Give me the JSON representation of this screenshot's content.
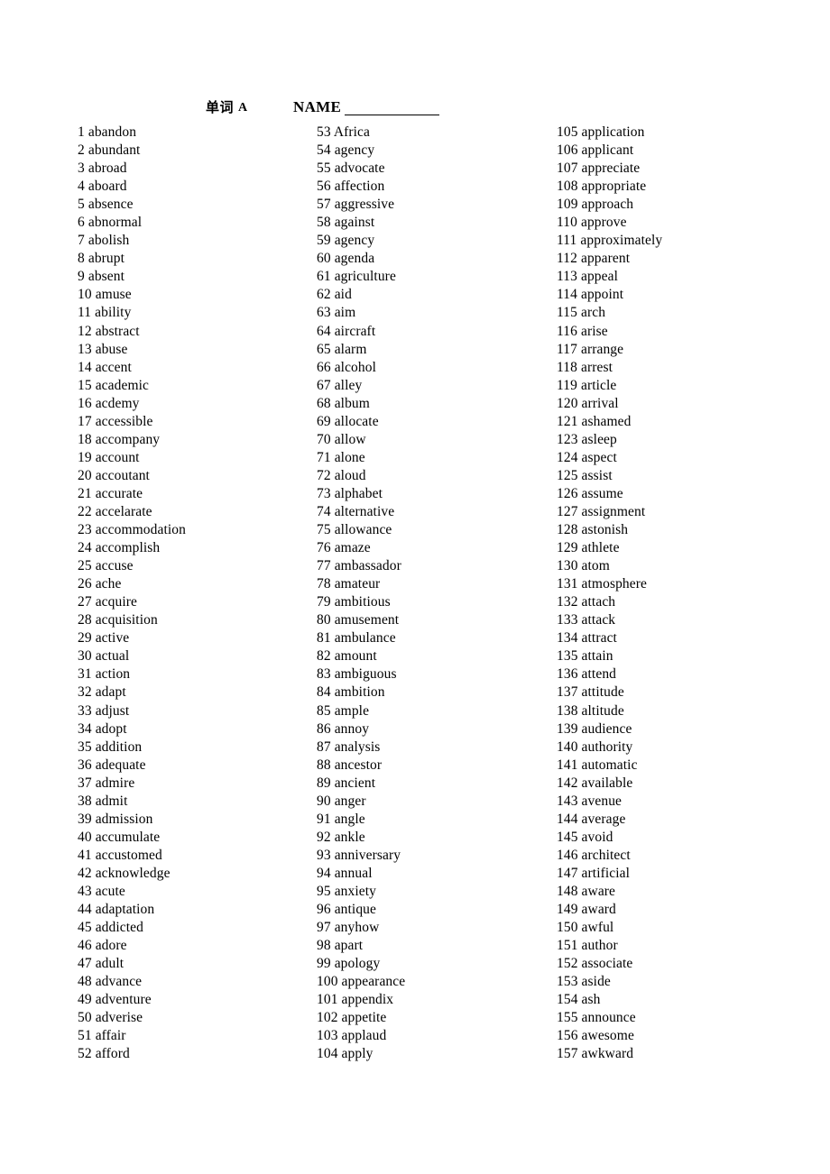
{
  "header": {
    "title_cjk": "单词",
    "title_letter": "A",
    "name_label": "NAME",
    "name_value": ""
  },
  "columns": [
    {
      "id": "column-1",
      "entries": [
        {
          "num": "1",
          "word": "abandon"
        },
        {
          "num": "2",
          "word": "abundant"
        },
        {
          "num": "3",
          "word": "abroad"
        },
        {
          "num": "4",
          "word": "aboard"
        },
        {
          "num": "5",
          "word": "absence"
        },
        {
          "num": "6",
          "word": "abnormal"
        },
        {
          "num": "7",
          "word": "abolish"
        },
        {
          "num": "8",
          "word": "abrupt"
        },
        {
          "num": "9",
          "word": "absent"
        },
        {
          "num": "10",
          "word": "amuse"
        },
        {
          "num": "11",
          "word": "ability"
        },
        {
          "num": "12",
          "word": "abstract"
        },
        {
          "num": "13",
          "word": "abuse"
        },
        {
          "num": "14",
          "word": "accent"
        },
        {
          "num": "15",
          "word": "academic"
        },
        {
          "num": "16",
          "word": "acdemy"
        },
        {
          "num": "17",
          "word": "accessible"
        },
        {
          "num": "18",
          "word": "accompany"
        },
        {
          "num": "19",
          "word": "account"
        },
        {
          "num": "20",
          "word": "accoutant"
        },
        {
          "num": "21",
          "word": "accurate"
        },
        {
          "num": "22",
          "word": "accelarate"
        },
        {
          "num": "23",
          "word": "accommodation"
        },
        {
          "num": "24",
          "word": "accomplish"
        },
        {
          "num": "25",
          "word": "accuse"
        },
        {
          "num": "26",
          "word": "ache"
        },
        {
          "num": "27",
          "word": "acquire"
        },
        {
          "num": "28",
          "word": "acquisition"
        },
        {
          "num": "29",
          "word": "active"
        },
        {
          "num": "30",
          "word": "actual"
        },
        {
          "num": "31",
          "word": "action"
        },
        {
          "num": "32",
          "word": "adapt"
        },
        {
          "num": "33",
          "word": "adjust"
        },
        {
          "num": "34",
          "word": "adopt"
        },
        {
          "num": "35",
          "word": "addition"
        },
        {
          "num": "36",
          "word": "adequate"
        },
        {
          "num": "37",
          "word": "admire"
        },
        {
          "num": "38",
          "word": "admit"
        },
        {
          "num": "39",
          "word": "admission"
        },
        {
          "num": "40",
          "word": "accumulate"
        },
        {
          "num": "41",
          "word": "accustomed"
        },
        {
          "num": "42",
          "word": "acknowledge"
        },
        {
          "num": "43",
          "word": "acute"
        },
        {
          "num": "44",
          "word": "adaptation"
        },
        {
          "num": "45",
          "word": "addicted"
        },
        {
          "num": "46",
          "word": "adore"
        },
        {
          "num": "47",
          "word": "adult"
        },
        {
          "num": "48",
          "word": "advance"
        },
        {
          "num": "49",
          "word": "adventure"
        },
        {
          "num": "50",
          "word": "adverise"
        },
        {
          "num": "51",
          "word": "affair"
        },
        {
          "num": "52",
          "word": "afford"
        }
      ]
    },
    {
      "id": "column-2",
      "entries": [
        {
          "num": "53",
          "word": "Africa"
        },
        {
          "num": "54",
          "word": "agency"
        },
        {
          "num": "55",
          "word": "advocate"
        },
        {
          "num": "56",
          "word": "affection"
        },
        {
          "num": "57",
          "word": "aggressive"
        },
        {
          "num": "58",
          "word": "against"
        },
        {
          "num": "59",
          "word": "agency"
        },
        {
          "num": "60",
          "word": "agenda"
        },
        {
          "num": "61",
          "word": "agriculture"
        },
        {
          "num": "62",
          "word": "aid"
        },
        {
          "num": "63",
          "word": "aim"
        },
        {
          "num": "64",
          "word": "aircraft"
        },
        {
          "num": "65",
          "word": "alarm"
        },
        {
          "num": "66",
          "word": "alcohol"
        },
        {
          "num": "67",
          "word": "alley"
        },
        {
          "num": "68",
          "word": "album"
        },
        {
          "num": "69",
          "word": "allocate"
        },
        {
          "num": "70",
          "word": "allow"
        },
        {
          "num": "71",
          "word": "alone"
        },
        {
          "num": "72",
          "word": "aloud"
        },
        {
          "num": "73",
          "word": "alphabet"
        },
        {
          "num": "74",
          "word": "alternative"
        },
        {
          "num": "75",
          "word": "allowance"
        },
        {
          "num": "76",
          "word": "amaze"
        },
        {
          "num": "77",
          "word": "ambassador"
        },
        {
          "num": "78",
          "word": "amateur"
        },
        {
          "num": "79",
          "word": "ambitious"
        },
        {
          "num": "80",
          "word": "amusement"
        },
        {
          "num": "81",
          "word": "ambulance"
        },
        {
          "num": "82",
          "word": "amount"
        },
        {
          "num": "83",
          "word": "ambiguous"
        },
        {
          "num": "84",
          "word": "ambition"
        },
        {
          "num": "85",
          "word": "ample"
        },
        {
          "num": "86",
          "word": "annoy"
        },
        {
          "num": "87",
          "word": "analysis"
        },
        {
          "num": "88",
          "word": "ancestor"
        },
        {
          "num": "89",
          "word": "ancient"
        },
        {
          "num": "90",
          "word": "anger"
        },
        {
          "num": "91",
          "word": "angle"
        },
        {
          "num": "92",
          "word": "ankle"
        },
        {
          "num": "93",
          "word": "anniversary"
        },
        {
          "num": "94",
          "word": "annual"
        },
        {
          "num": "95",
          "word": "anxiety"
        },
        {
          "num": "96",
          "word": "antique"
        },
        {
          "num": "97",
          "word": "anyhow"
        },
        {
          "num": "98",
          "word": "apart"
        },
        {
          "num": "99",
          "word": "apology"
        },
        {
          "num": "100",
          "word": "appearance"
        },
        {
          "num": "101",
          "word": "appendix"
        },
        {
          "num": "102",
          "word": "appetite"
        },
        {
          "num": "103",
          "word": "applaud"
        },
        {
          "num": "104",
          "word": "apply"
        }
      ]
    },
    {
      "id": "column-3",
      "entries": [
        {
          "num": "105",
          "word": "application"
        },
        {
          "num": "106",
          "word": "applicant"
        },
        {
          "num": "107",
          "word": "appreciate"
        },
        {
          "num": "108",
          "word": "appropriate"
        },
        {
          "num": "109",
          "word": "approach"
        },
        {
          "num": "110",
          "word": "approve"
        },
        {
          "num": "111",
          "word": "approximately"
        },
        {
          "num": "112",
          "word": "apparent"
        },
        {
          "num": "113",
          "word": "appeal"
        },
        {
          "num": "114",
          "word": "appoint"
        },
        {
          "num": "115",
          "word": "arch"
        },
        {
          "num": "116",
          "word": "arise"
        },
        {
          "num": "117",
          "word": "arrange"
        },
        {
          "num": "118",
          "word": "arrest"
        },
        {
          "num": "119",
          "word": "article"
        },
        {
          "num": "120",
          "word": "arrival"
        },
        {
          "num": "121",
          "word": "ashamed"
        },
        {
          "num": "123",
          "word": "asleep"
        },
        {
          "num": "124",
          "word": "aspect"
        },
        {
          "num": "125",
          "word": "assist"
        },
        {
          "num": "126",
          "word": "assume"
        },
        {
          "num": "127",
          "word": "assignment"
        },
        {
          "num": "128",
          "word": "astonish"
        },
        {
          "num": "129",
          "word": "athlete"
        },
        {
          "num": "130",
          "word": "atom"
        },
        {
          "num": "131",
          "word": "atmosphere"
        },
        {
          "num": "132",
          "word": "attach"
        },
        {
          "num": "133",
          "word": "attack"
        },
        {
          "num": "134",
          "word": "attract"
        },
        {
          "num": "135",
          "word": "attain"
        },
        {
          "num": "136",
          "word": "attend"
        },
        {
          "num": "137",
          "word": "attitude"
        },
        {
          "num": "138",
          "word": "altitude"
        },
        {
          "num": "139",
          "word": "audience"
        },
        {
          "num": "140",
          "word": "authority"
        },
        {
          "num": "141",
          "word": "automatic"
        },
        {
          "num": "142",
          "word": "available"
        },
        {
          "num": "143",
          "word": "avenue"
        },
        {
          "num": "144",
          "word": "average"
        },
        {
          "num": "145",
          "word": "avoid"
        },
        {
          "num": "146",
          "word": "architect"
        },
        {
          "num": "147",
          "word": "artificial"
        },
        {
          "num": "148",
          "word": "aware"
        },
        {
          "num": "149",
          "word": "award"
        },
        {
          "num": "150",
          "word": "awful"
        },
        {
          "num": "151",
          "word": "author"
        },
        {
          "num": "152",
          "word": "associate"
        },
        {
          "num": "153",
          "word": "aside"
        },
        {
          "num": "154",
          "word": "ash"
        },
        {
          "num": "155",
          "word": "announce"
        },
        {
          "num": "156",
          "word": "awesome"
        },
        {
          "num": "157",
          "word": "awkward"
        }
      ]
    }
  ]
}
